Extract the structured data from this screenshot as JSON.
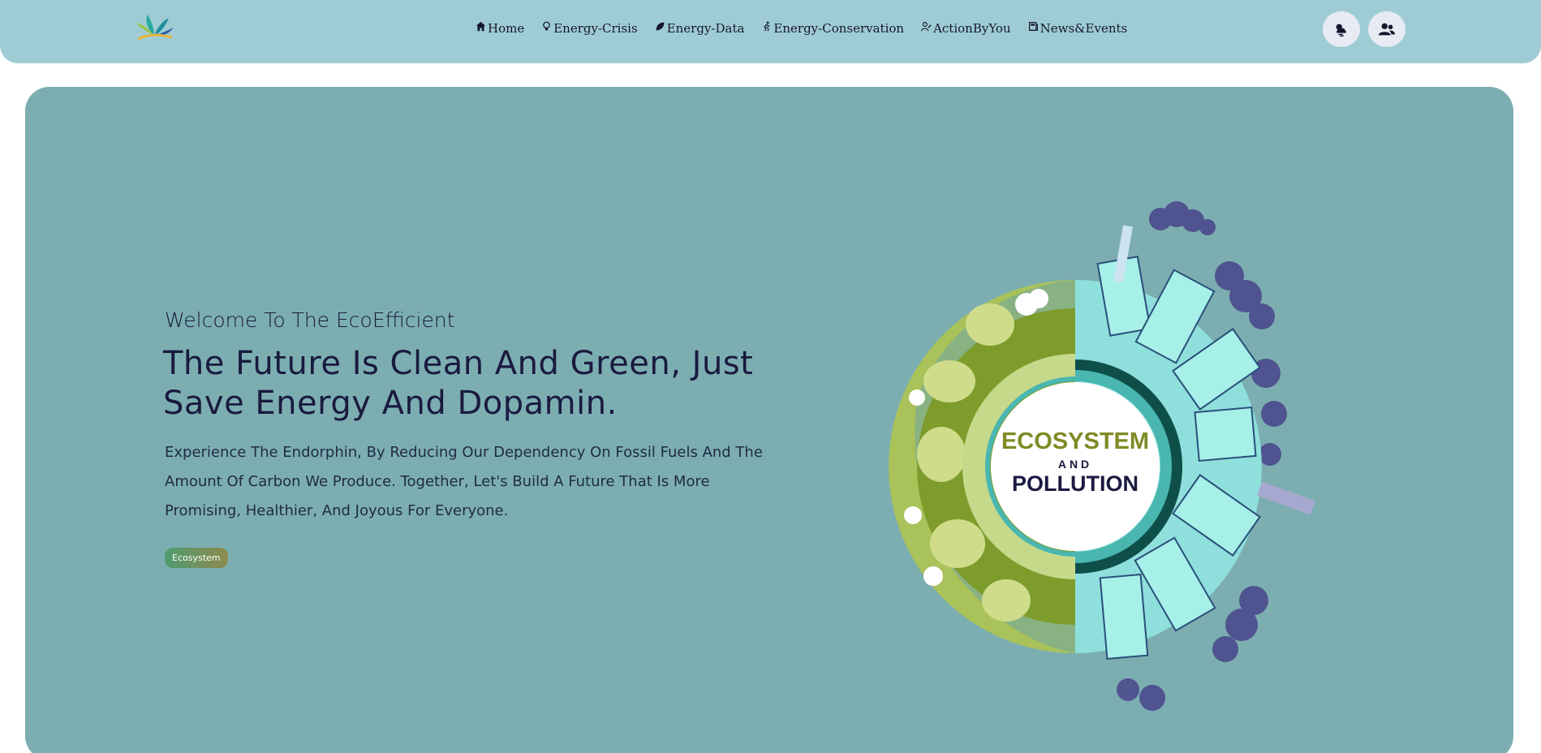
{
  "header": {
    "nav": [
      {
        "label": "Home",
        "icon": "home-icon"
      },
      {
        "label": "Energy-Crisis",
        "icon": "bulb-icon"
      },
      {
        "label": "Energy-Data",
        "icon": "leaf-icon"
      },
      {
        "label": "Energy-Conservation",
        "icon": "running-person-icon"
      },
      {
        "label": "ActionByYou",
        "icon": "person-edit-icon"
      },
      {
        "label": "News&Events",
        "icon": "newspaper-icon"
      }
    ],
    "actions": [
      {
        "name": "weather-icon"
      },
      {
        "name": "users-icon"
      }
    ]
  },
  "hero": {
    "welcome": "Welcome To The EcoEfficient",
    "headline": "The Future Is Clean And Green, Just Save Energy And Dopamin.",
    "description": "Experience The Endorphin, By Reducing Our Dependency On Fossil Fuels And The Amount Of Carbon We Produce. Together, Let's Build A Future That Is More Promising, Healthier, And Joyous For Everyone.",
    "tag": "Ecosystem",
    "illustration": {
      "line1": "ECOSYSTEM",
      "line2": "AND",
      "line3": "POLLUTION"
    }
  },
  "colors": {
    "header_bg": "#9fccd4",
    "hero_bg": "#7caeb1",
    "text_dark": "#1a1a40"
  }
}
